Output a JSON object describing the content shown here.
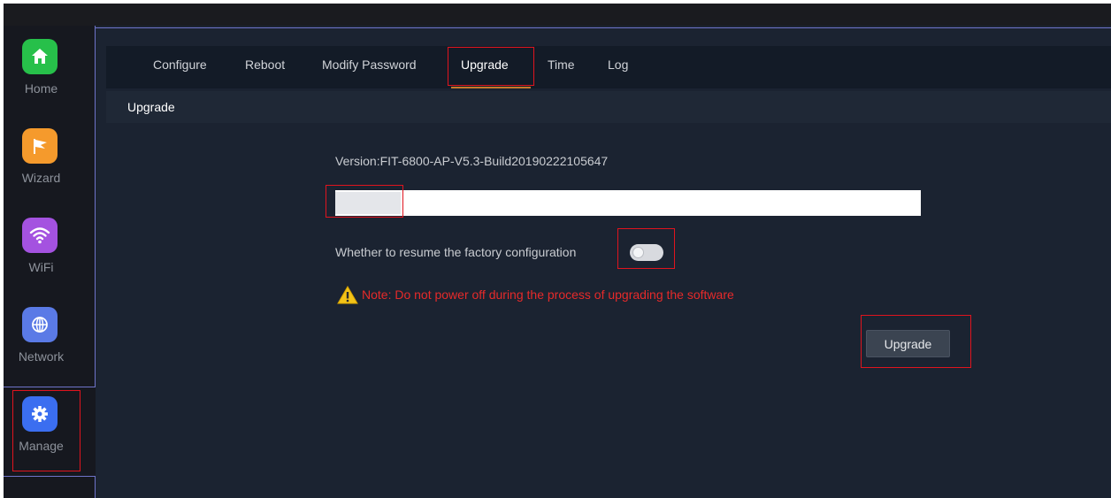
{
  "sidebar": {
    "items": [
      {
        "label": "Home",
        "icon": "home-icon",
        "color": "#27c04a"
      },
      {
        "label": "Wizard",
        "icon": "flag-icon",
        "color": "#f59a2c"
      },
      {
        "label": "WiFi",
        "icon": "wifi-icon",
        "color": "#a452e0"
      },
      {
        "label": "Network",
        "icon": "globe-icon",
        "color": "#5a7ae6"
      },
      {
        "label": "Manage",
        "icon": "gear-icon",
        "color": "#3b6ef0"
      }
    ]
  },
  "tabs": {
    "items": [
      "Configure",
      "Reboot",
      "Modify Password",
      "Upgrade",
      "Time",
      "Log"
    ],
    "active": "Upgrade"
  },
  "section": {
    "title": "Upgrade"
  },
  "upgrade": {
    "version": "Version:FIT-6800-AP-V5.3-Build20190222105647",
    "factory_label": "Whether to resume the factory configuration",
    "factory_toggle": "off",
    "note": "Note: Do not power off during the process of upgrading the software",
    "button_label": "Upgrade"
  },
  "colors": {
    "background": "#1b2331",
    "sidebar": "#16181f",
    "warning_text": "#e62a2a",
    "active_tab_underline": "#c77a2a",
    "highlight_box": "#e0141e"
  }
}
